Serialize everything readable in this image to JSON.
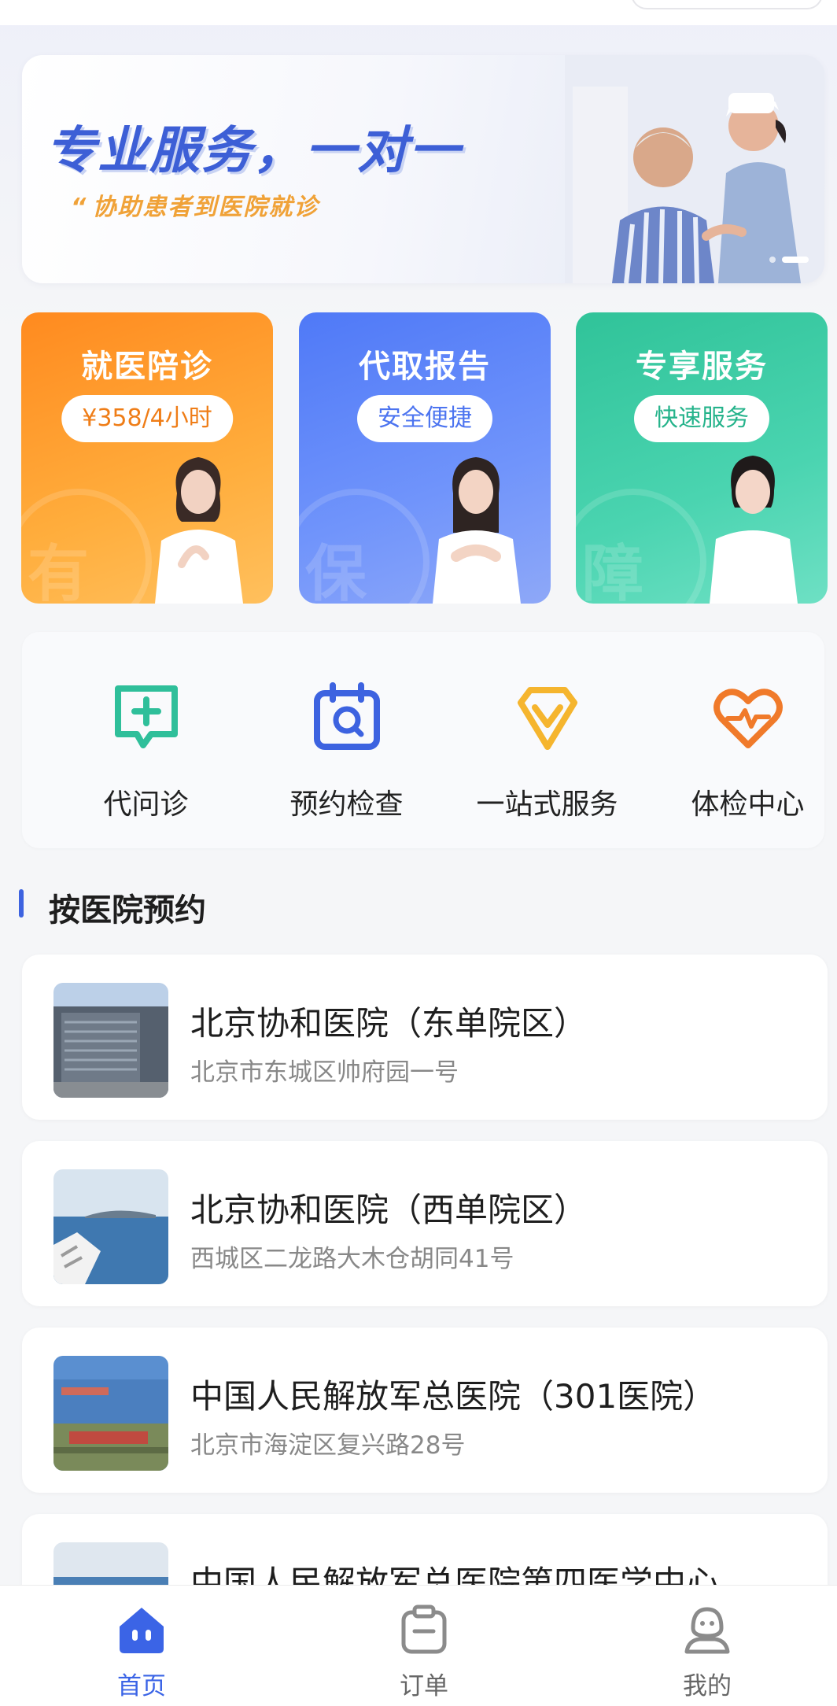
{
  "banner": {
    "title": "专业服务，一对一",
    "subtitle": "协助患者到医院就诊",
    "quote_mark": "“"
  },
  "services": [
    {
      "title": "就医陪诊",
      "tag": "¥358/4小时",
      "watermark": "有"
    },
    {
      "title": "代取报告",
      "tag": "安全便捷",
      "watermark": "保"
    },
    {
      "title": "专享服务",
      "tag": "快速服务",
      "watermark": "障"
    }
  ],
  "quick_actions": [
    {
      "label": "代问诊",
      "icon": "chat-plus-icon",
      "color": "#2fbf9a"
    },
    {
      "label": "预约检查",
      "icon": "calendar-check-icon",
      "color": "#3d63e0"
    },
    {
      "label": "一站式服务",
      "icon": "diamond-check-icon",
      "color": "#f5b52e"
    },
    {
      "label": "体检中心",
      "icon": "heart-pulse-icon",
      "color": "#f07a2a"
    }
  ],
  "section": {
    "title": "按医院预约"
  },
  "hospitals": [
    {
      "name": "北京协和医院（东单院区）",
      "address": "北京市东城区帅府园一号"
    },
    {
      "name": "北京协和医院（西单院区）",
      "address": "西城区二龙路大木仓胡同41号"
    },
    {
      "name": "中国人民解放军总医院（301医院）",
      "address": "北京市海淀区复兴路28号"
    },
    {
      "name": "中国人民解放军总医院第四医学中心",
      "address": ""
    }
  ],
  "tabbar": [
    {
      "label": "首页",
      "icon": "home-icon",
      "active": true
    },
    {
      "label": "订单",
      "icon": "clipboard-icon",
      "active": false
    },
    {
      "label": "我的",
      "icon": "user-icon",
      "active": false
    }
  ],
  "colors": {
    "primary": "#3b64e6",
    "orange": "#ff8a1f",
    "green": "#30c399"
  }
}
